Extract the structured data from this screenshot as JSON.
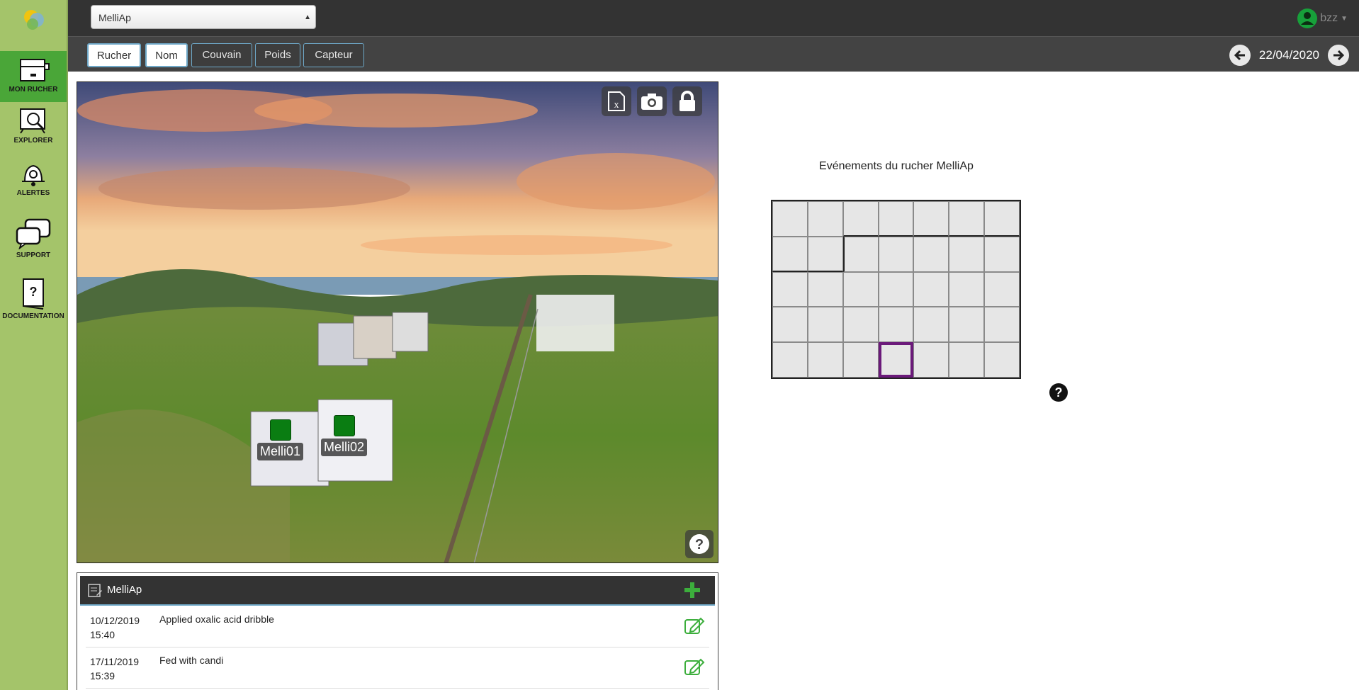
{
  "header": {
    "apiary_select": {
      "value": "MelliAp",
      "options": [
        "MelliAp"
      ]
    },
    "user": {
      "name": "bzz"
    }
  },
  "sidebar": {
    "items": [
      {
        "label": "MON RUCHER",
        "icon": "beehive-box-icon",
        "active": true
      },
      {
        "label": "EXPLORER",
        "icon": "magnifier-board-icon",
        "active": false
      },
      {
        "label": "ALERTES",
        "icon": "bell-gear-icon",
        "active": false
      },
      {
        "label": "SUPPORT",
        "icon": "chat-bubbles-icon",
        "active": false
      },
      {
        "label": "DOCUMENTATION",
        "icon": "question-book-icon",
        "active": false
      }
    ]
  },
  "toolbar": {
    "buttons": [
      {
        "label": "Rucher",
        "selected": true
      },
      {
        "label": "Nom",
        "selected": true
      },
      {
        "label": "Couvain",
        "selected": false
      },
      {
        "label": "Poids",
        "selected": false
      },
      {
        "label": "Capteur",
        "selected": false
      }
    ],
    "date": "22/04/2020"
  },
  "photo": {
    "tools": [
      "excel-export-icon",
      "camera-icon",
      "lock-icon"
    ],
    "hives": [
      {
        "name": "Melli01",
        "status_color": "#0a7d12"
      },
      {
        "name": "Melli02",
        "status_color": "#0a7d12"
      }
    ]
  },
  "events": {
    "apiary_name": "MelliAp",
    "rows": [
      {
        "date": "10/12/2019",
        "time": "15:40",
        "description": "Applied oxalic acid dribble"
      },
      {
        "date": "17/11/2019",
        "time": "15:39",
        "description": "Fed with candi"
      }
    ]
  },
  "calendar": {
    "title": "Evénements du rucher MelliAp",
    "rows": 5,
    "columns": 7
  },
  "colors": {
    "sidebar_bg": "#a4c46a",
    "active_nav": "#4aa638",
    "hive_ok": "#0a7d12",
    "today_border": "#6b1a7a"
  }
}
